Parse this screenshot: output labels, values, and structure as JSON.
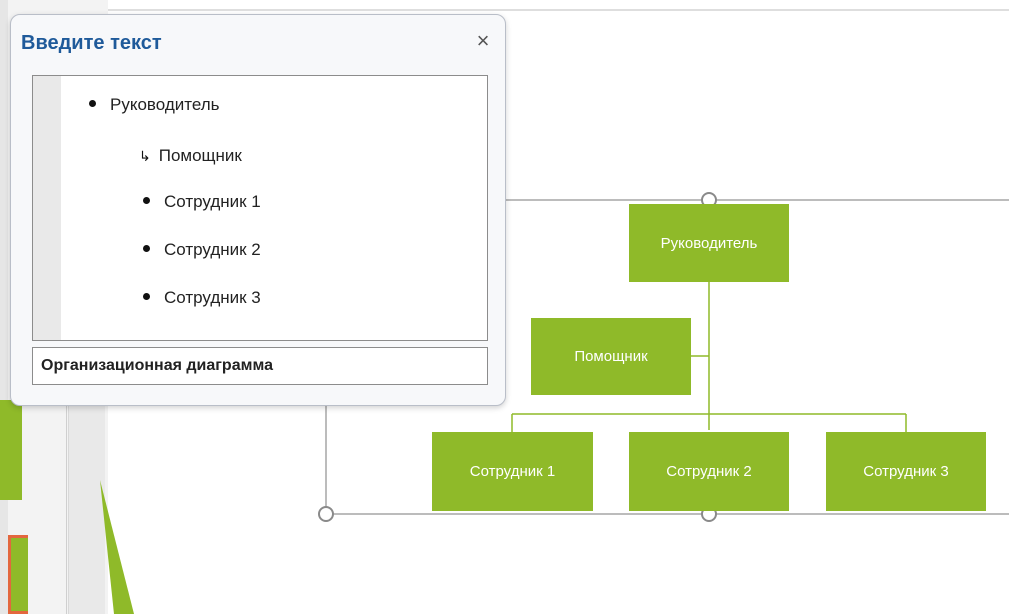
{
  "text_pane": {
    "title": "Введите текст",
    "close_glyph": "×",
    "items": [
      {
        "label": "Руководитель",
        "level": 1,
        "marker": "bullet"
      },
      {
        "label": "Помощник",
        "level": 2,
        "marker": "assistant-arrow"
      },
      {
        "label": "Сотрудник 1",
        "level": 2,
        "marker": "bullet"
      },
      {
        "label": "Сотрудник 2",
        "level": 2,
        "marker": "bullet"
      },
      {
        "label": "Сотрудник 3",
        "level": 2,
        "marker": "bullet"
      }
    ],
    "footer": "Организационная диаграмма"
  },
  "org_chart": {
    "manager": "Руководитель",
    "assistant": "Помощник",
    "employees": [
      "Сотрудник 1",
      "Сотрудник 2",
      "Сотрудник 3"
    ]
  },
  "colors": {
    "box_fill": "#8fba29",
    "box_text": "#ffffff",
    "pane_title": "#1f5a9a",
    "selection_accent": "#e3673e"
  }
}
